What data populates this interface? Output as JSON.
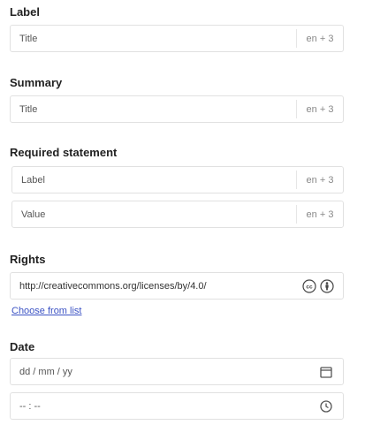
{
  "label_section": {
    "heading": "Label",
    "input": {
      "placeholder": "Title",
      "lang": "en + 3"
    }
  },
  "summary_section": {
    "heading": "Summary",
    "input": {
      "placeholder": "Title",
      "lang": "en + 3"
    }
  },
  "required_statement_section": {
    "heading": "Required statement",
    "label_input": {
      "placeholder": "Label",
      "lang": "en + 3"
    },
    "value_input": {
      "placeholder": "Value",
      "lang": "en + 3"
    }
  },
  "rights_section": {
    "heading": "Rights",
    "input": {
      "value": "http://creativecommons.org/licenses/by/4.0/",
      "icons": [
        "creative-commons-icon",
        "attribution-icon"
      ]
    },
    "choose_link": "Choose from list"
  },
  "date_section": {
    "heading": "Date",
    "date_input": {
      "placeholder": "dd / mm / yy",
      "icon": "calendar-icon"
    },
    "time_input": {
      "placeholder": "-- : --",
      "icon": "clock-icon"
    }
  }
}
